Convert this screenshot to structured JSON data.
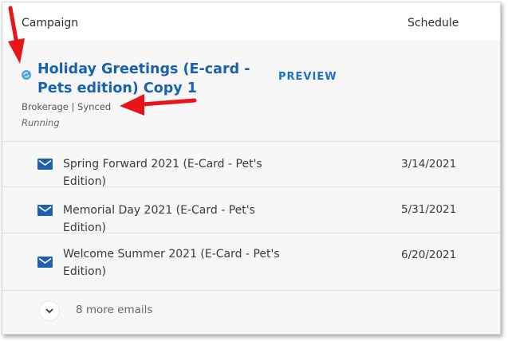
{
  "headers": {
    "campaign": "Campaign",
    "schedule": "Schedule"
  },
  "campaign": {
    "title": "Holiday Greetings (E-card - Pets edition) Copy 1",
    "preview_label": "PREVIEW",
    "meta": "Brokerage | Synced",
    "status": "Running",
    "icon": "sync-icon",
    "title_color": "#1762b0"
  },
  "emails": [
    {
      "name": "Spring Forward 2021 (E-Card - Pet's Edition)",
      "date": "3/14/2021",
      "icon": "mail-icon"
    },
    {
      "name": "Memorial Day 2021 (E-Card - Pet's Edition)",
      "date": "5/31/2021",
      "icon": "mail-icon"
    },
    {
      "name": "Welcome Summer 2021 (E-Card - Pet's Edition)",
      "date": "6/20/2021",
      "icon": "mail-icon"
    }
  ],
  "more": {
    "label": "8 more emails",
    "icon": "chevron-down-icon"
  },
  "colors": {
    "accent": "#1d6fc4",
    "mail_icon": "#1f5fb0",
    "annotation_arrow": "#e8141a"
  }
}
